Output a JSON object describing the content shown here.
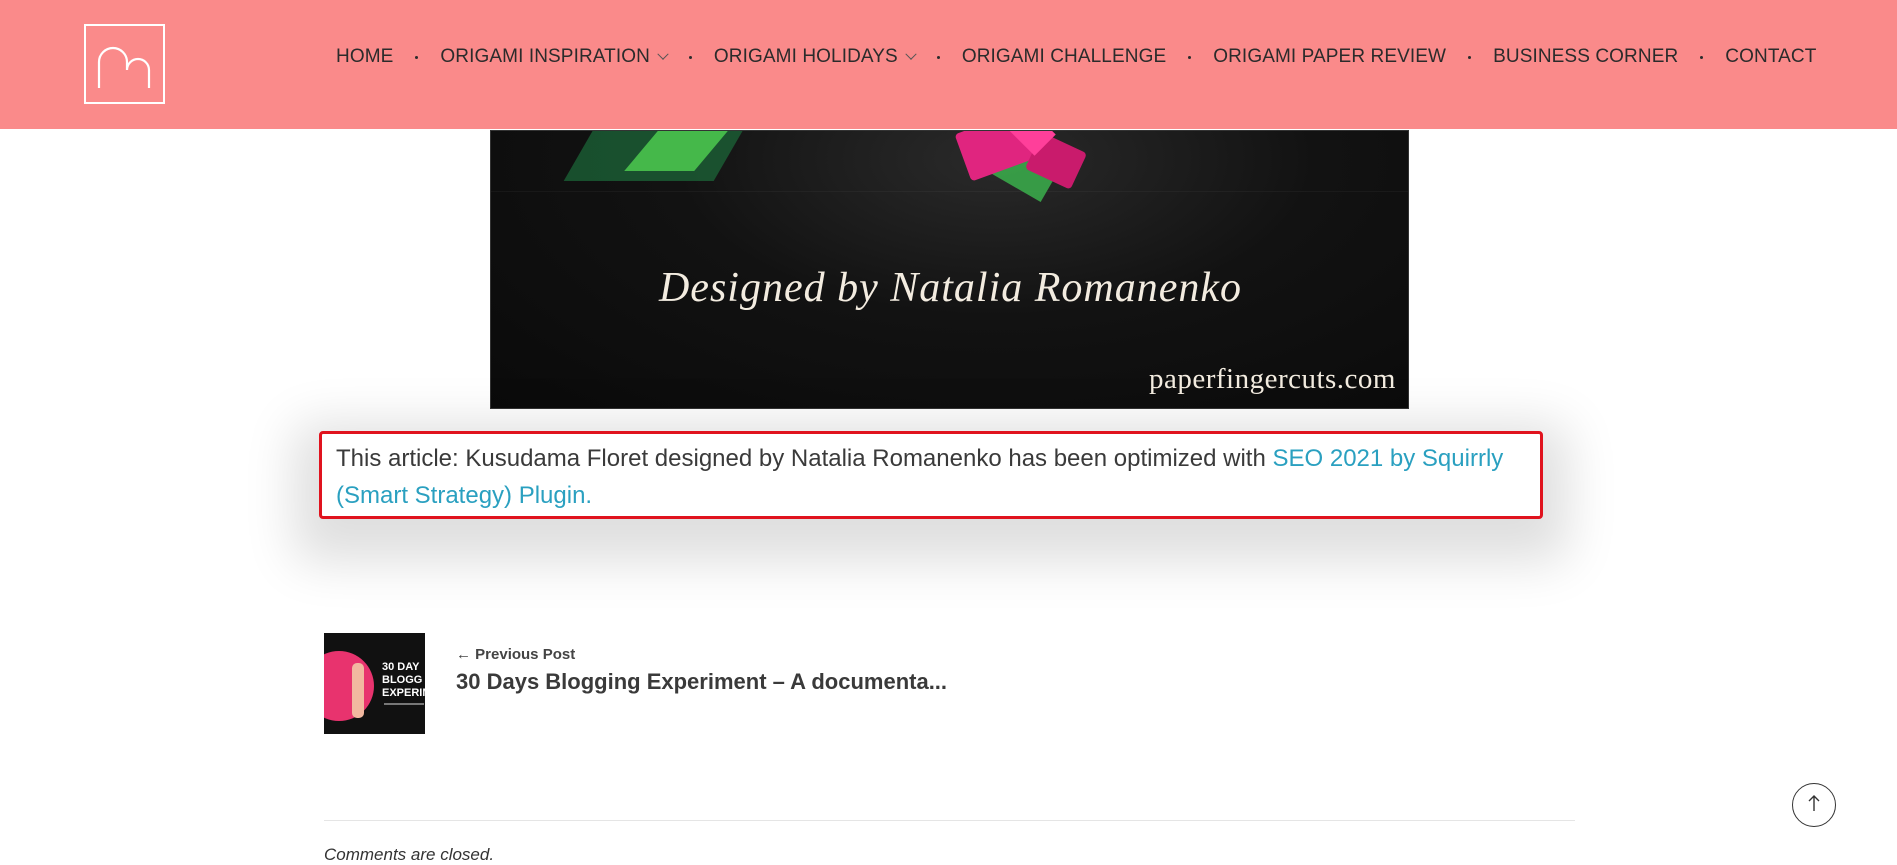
{
  "header": {
    "logo_icon": "logo-m-icon",
    "nav": [
      {
        "label": "HOME",
        "dropdown": false
      },
      {
        "label": "ORIGAMI INSPIRATION",
        "dropdown": true
      },
      {
        "label": "ORIGAMI HOLIDAYS",
        "dropdown": true
      },
      {
        "label": "ORIGAMI CHALLENGE",
        "dropdown": false
      },
      {
        "label": "ORIGAMI PAPER REVIEW",
        "dropdown": false
      },
      {
        "label": "BUSINESS CORNER",
        "dropdown": false
      },
      {
        "label": "CONTACT",
        "dropdown": false
      }
    ],
    "background_color": "#fa8a8a"
  },
  "hero": {
    "caption": "Designed by Natalia Romanenko",
    "watermark": "paperfingercuts.com"
  },
  "seo_notice": {
    "text": "This article: Kusudama Floret designed by Natalia Romanenko has been optimized with ",
    "link_text": "SEO 2021 by Squirrly (Smart Strategy) Plugin.",
    "border_color": "#e0131e",
    "link_color": "#2aa0c0"
  },
  "post_navigation": {
    "previous_label": "← Previous Post",
    "previous_title": "30 Days Blogging Experiment – A documenta...",
    "thumbnail_text": [
      "30 DAY",
      "BLOGG",
      "EXPERIM"
    ]
  },
  "comments": {
    "status": "Comments are closed."
  },
  "scroll_top_icon": "arrow-up-icon"
}
